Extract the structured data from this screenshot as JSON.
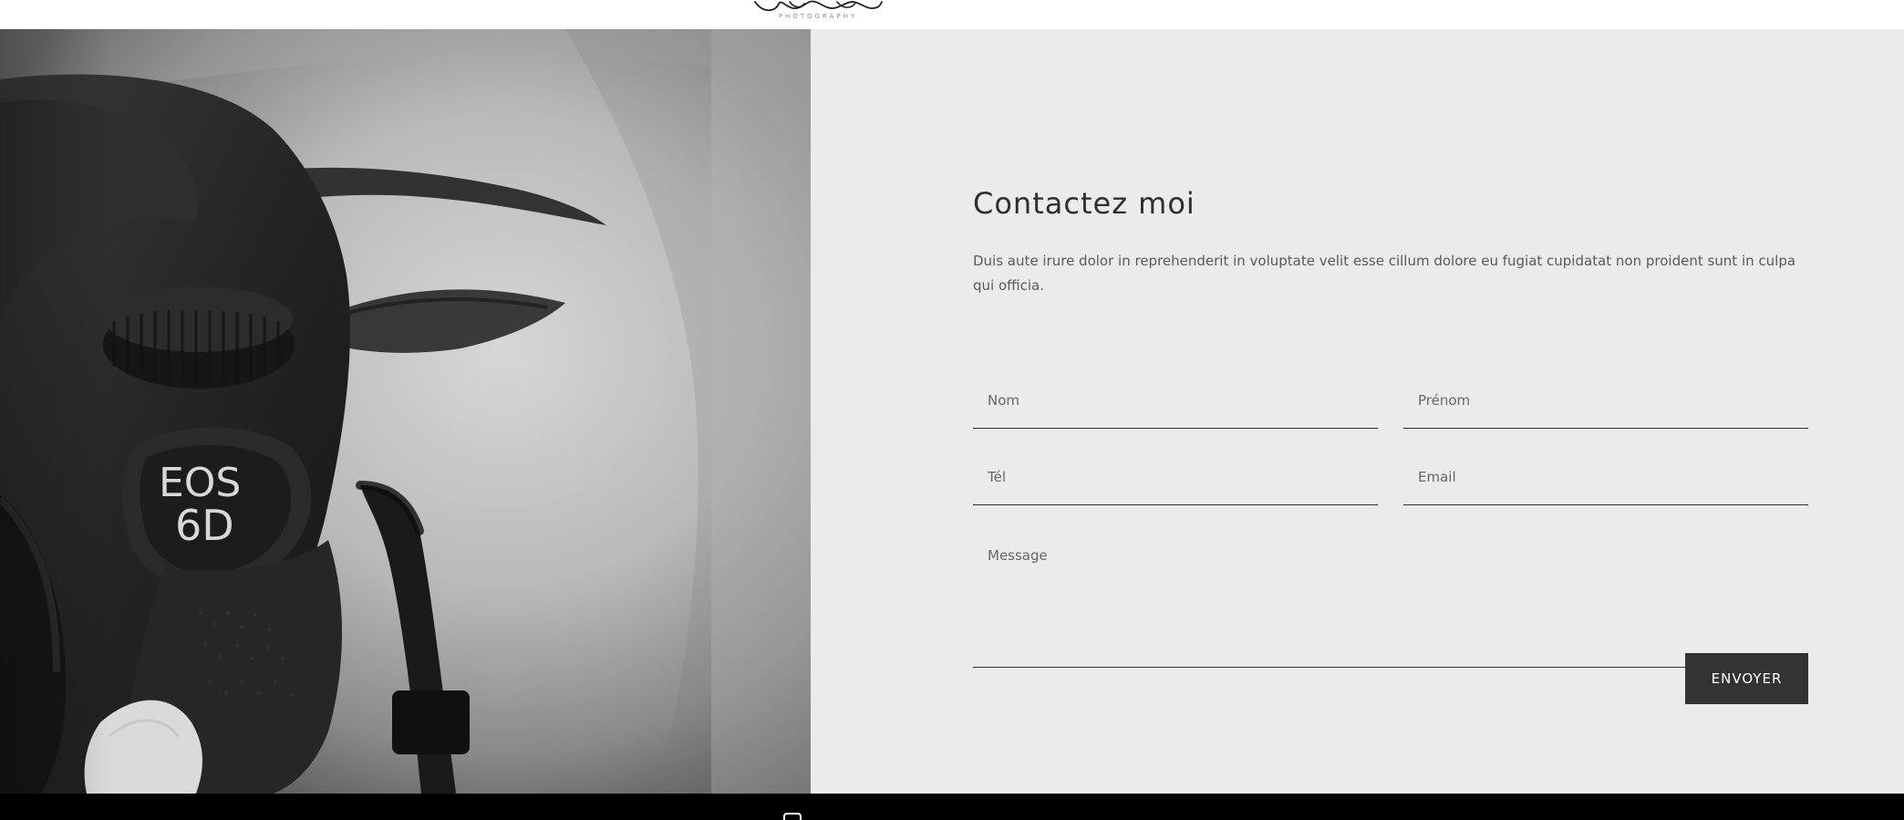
{
  "header": {
    "logo_script": "Alex",
    "logo_sub": "PHOTOGRAPHY"
  },
  "photo": {
    "camera_model_line1": "EOS",
    "camera_model_line2": "6D"
  },
  "contact": {
    "title": "Contactez moi",
    "intro": "Duis aute irure dolor in reprehenderit in voluptate velit esse cillum dolore eu fugiat cupidatat non proident sunt in culpa qui officia.",
    "fields": {
      "nom": {
        "placeholder": "Nom",
        "value": ""
      },
      "prenom": {
        "placeholder": "Prénom",
        "value": ""
      },
      "tel": {
        "placeholder": "Tél",
        "value": ""
      },
      "email": {
        "placeholder": "Email",
        "value": ""
      },
      "message": {
        "placeholder": "Message",
        "value": ""
      }
    },
    "submit_label": "ENVOYER"
  },
  "colors": {
    "panel_background": "#ebebeb",
    "button_background": "#333333",
    "footer_background": "#000000",
    "text_dark": "#2f2f2f"
  },
  "icons": {
    "footer_icon": "social-icon"
  }
}
